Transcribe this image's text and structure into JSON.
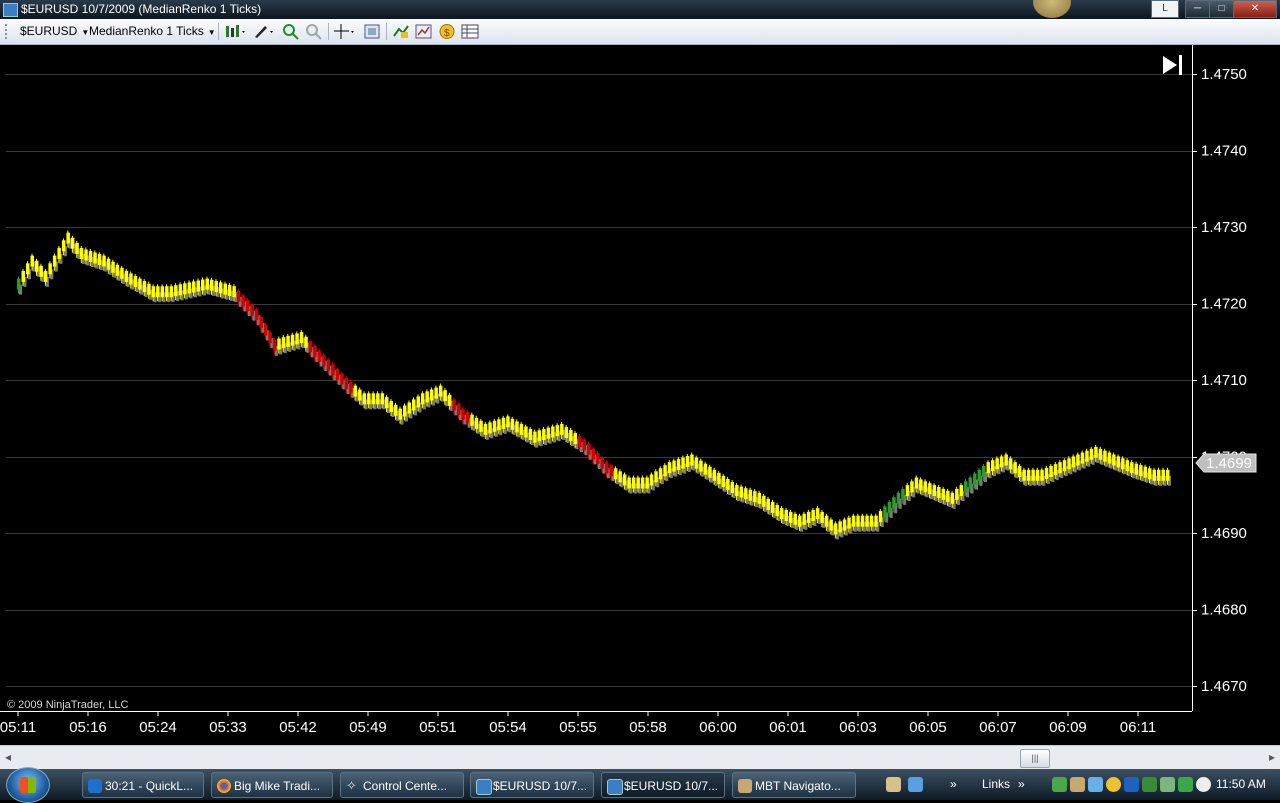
{
  "window": {
    "title": "$EURUSD  10/7/2009 (MedianRenko 1 Ticks)",
    "btn_help": "L",
    "btn_min": "─",
    "btn_max": "□",
    "btn_close": "✕"
  },
  "toolbar": {
    "instrument": "$EURUSD",
    "bartype": "MedianRenko 1 Ticks",
    "icons": [
      "chart-style-icon",
      "drawing-tool-icon",
      "zoom-in-icon",
      "zoom-out-icon",
      "crosshair-icon",
      "properties-icon",
      "indicators-icon",
      "strategies-icon",
      "order-icon",
      "data-box-icon"
    ]
  },
  "chart": {
    "price_axis": [
      "1.4750",
      "1.4740",
      "1.4730",
      "1.4720",
      "1.4710",
      "1.4700",
      "1.4690",
      "1.4680",
      "1.4670"
    ],
    "time_axis": [
      "05:11",
      "05:16",
      "05:24",
      "05:33",
      "05:42",
      "05:49",
      "05:51",
      "05:54",
      "05:55",
      "05:58",
      "06:00",
      "06:01",
      "06:03",
      "06:05",
      "06:07",
      "06:09",
      "06:11"
    ],
    "current_price": "1.4699",
    "copyright": "© 2009 NinjaTrader, LLC",
    "go_to_end_icon": "skip-to-end-icon",
    "colors": {
      "background": "#000000",
      "grid": "#3a3a3a",
      "axis_text": "#ffffff",
      "green": "#2e9a2e",
      "yellow": "#ffff00",
      "red": "#d40000",
      "white": "#ffffff",
      "shadow": "#7a7a7a"
    }
  },
  "chart_data": {
    "type": "candlestick",
    "title": "",
    "ylim": [
      1.4665,
      1.4755
    ],
    "y_ticks": [
      1.467,
      1.468,
      1.469,
      1.47,
      1.471,
      1.472,
      1.473,
      1.474,
      1.475
    ],
    "x_ticks": [
      "05:11",
      "05:16",
      "05:24",
      "05:33",
      "05:42",
      "05:49",
      "05:51",
      "05:54",
      "05:55",
      "05:58",
      "06:00",
      "06:01",
      "06:03",
      "06:05",
      "06:07",
      "06:09",
      "06:11"
    ],
    "grid": true,
    "last_price": 1.4699,
    "path": [
      {
        "i": 0,
        "p": 1.4723
      },
      {
        "i": 3,
        "p": 1.4726
      },
      {
        "i": 6,
        "p": 1.4724
      },
      {
        "i": 11,
        "p": 1.4729
      },
      {
        "i": 14,
        "p": 1.4727
      },
      {
        "i": 19,
        "p": 1.4726
      },
      {
        "i": 24,
        "p": 1.4724
      },
      {
        "i": 30,
        "p": 1.4722
      },
      {
        "i": 34,
        "p": 1.4722
      },
      {
        "i": 42,
        "p": 1.4723
      },
      {
        "i": 48,
        "p": 1.4722
      },
      {
        "i": 53,
        "p": 1.4719
      },
      {
        "i": 57,
        "p": 1.4715
      },
      {
        "i": 63,
        "p": 1.4716
      },
      {
        "i": 68,
        "p": 1.4713
      },
      {
        "i": 73,
        "p": 1.471
      },
      {
        "i": 77,
        "p": 1.4708
      },
      {
        "i": 81,
        "p": 1.4708
      },
      {
        "i": 85,
        "p": 1.4706
      },
      {
        "i": 90,
        "p": 1.4708
      },
      {
        "i": 94,
        "p": 1.4709
      },
      {
        "i": 99,
        "p": 1.4706
      },
      {
        "i": 104,
        "p": 1.4704
      },
      {
        "i": 109,
        "p": 1.4705
      },
      {
        "i": 115,
        "p": 1.4703
      },
      {
        "i": 121,
        "p": 1.4704
      },
      {
        "i": 126,
        "p": 1.4702
      },
      {
        "i": 131,
        "p": 1.4699
      },
      {
        "i": 136,
        "p": 1.4697
      },
      {
        "i": 140,
        "p": 1.4697
      },
      {
        "i": 145,
        "p": 1.4699
      },
      {
        "i": 150,
        "p": 1.47
      },
      {
        "i": 155,
        "p": 1.4698
      },
      {
        "i": 160,
        "p": 1.4696
      },
      {
        "i": 165,
        "p": 1.4695
      },
      {
        "i": 170,
        "p": 1.4693
      },
      {
        "i": 174,
        "p": 1.4692
      },
      {
        "i": 178,
        "p": 1.4693
      },
      {
        "i": 182,
        "p": 1.4691
      },
      {
        "i": 186,
        "p": 1.4692
      },
      {
        "i": 191,
        "p": 1.4692
      },
      {
        "i": 196,
        "p": 1.4695
      },
      {
        "i": 200,
        "p": 1.4697
      },
      {
        "i": 204,
        "p": 1.4696
      },
      {
        "i": 208,
        "p": 1.4695
      },
      {
        "i": 212,
        "p": 1.4697
      },
      {
        "i": 216,
        "p": 1.4699
      },
      {
        "i": 220,
        "p": 1.47
      },
      {
        "i": 224,
        "p": 1.4698
      },
      {
        "i": 228,
        "p": 1.4698
      },
      {
        "i": 232,
        "p": 1.4699
      },
      {
        "i": 236,
        "p": 1.47
      },
      {
        "i": 240,
        "p": 1.4701
      },
      {
        "i": 244,
        "p": 1.47
      },
      {
        "i": 248,
        "p": 1.4699
      },
      {
        "i": 253,
        "p": 1.4698
      },
      {
        "i": 256,
        "p": 1.4698
      }
    ]
  },
  "scrollbar": {
    "left_arrow": "◂",
    "right_arrow": "▸",
    "thumb_grip": "|||"
  },
  "taskbar": {
    "items": [
      {
        "label": "30:21 - QuickL...",
        "icon": "ie-icon"
      },
      {
        "label": "Big Mike Tradi...",
        "icon": "chrome-icon"
      },
      {
        "label": "Control Cente...",
        "icon": "ninjatrader-icon"
      },
      {
        "label": "$EURUSD  10/7...",
        "icon": "chart-window-icon"
      },
      {
        "label": "$EURUSD  10/7...",
        "icon": "chart-window-icon"
      },
      {
        "label": "MBT Navigato...",
        "icon": "mbt-icon"
      }
    ],
    "links": "Links",
    "chevron": "»",
    "clock": "11:50 AM"
  }
}
